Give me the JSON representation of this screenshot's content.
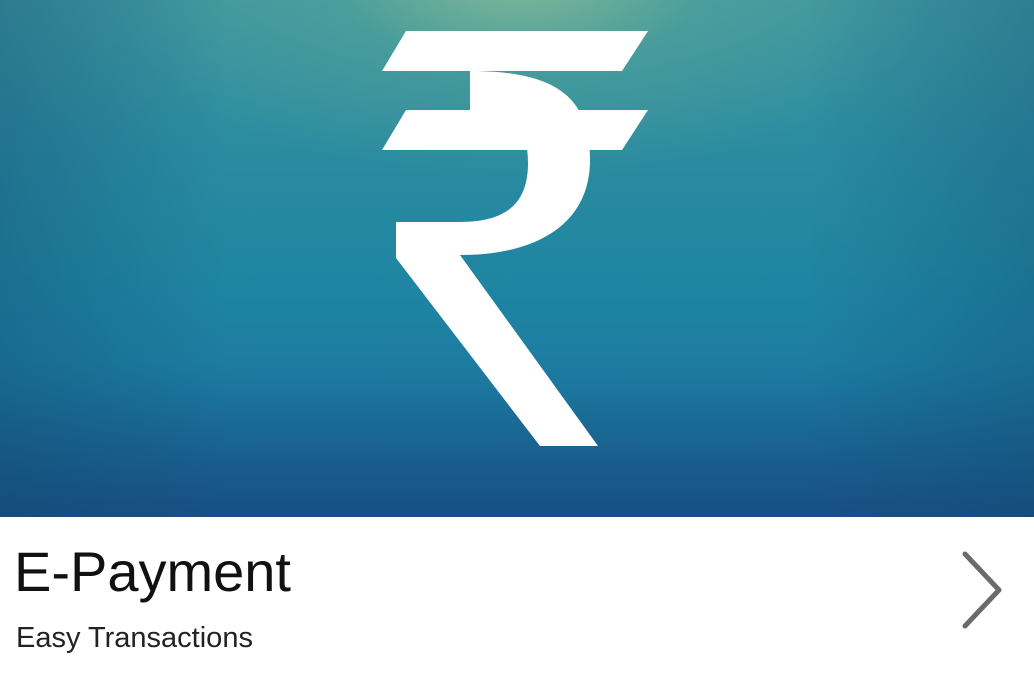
{
  "tile": {
    "icon": "rupee-icon",
    "title": "E-Payment",
    "subtitle": "Easy Transactions",
    "chevron_icon": "chevron-right-icon"
  },
  "colors": {
    "hero_top": "#3d97a0",
    "hero_mid": "#1f85a2",
    "hero_bottom": "#1a5f8e",
    "hero_highlight": "#8cbe96",
    "title_text": "#111111",
    "subtitle_text": "#222222",
    "chevron": "#6b6b6b",
    "icon": "#ffffff"
  }
}
